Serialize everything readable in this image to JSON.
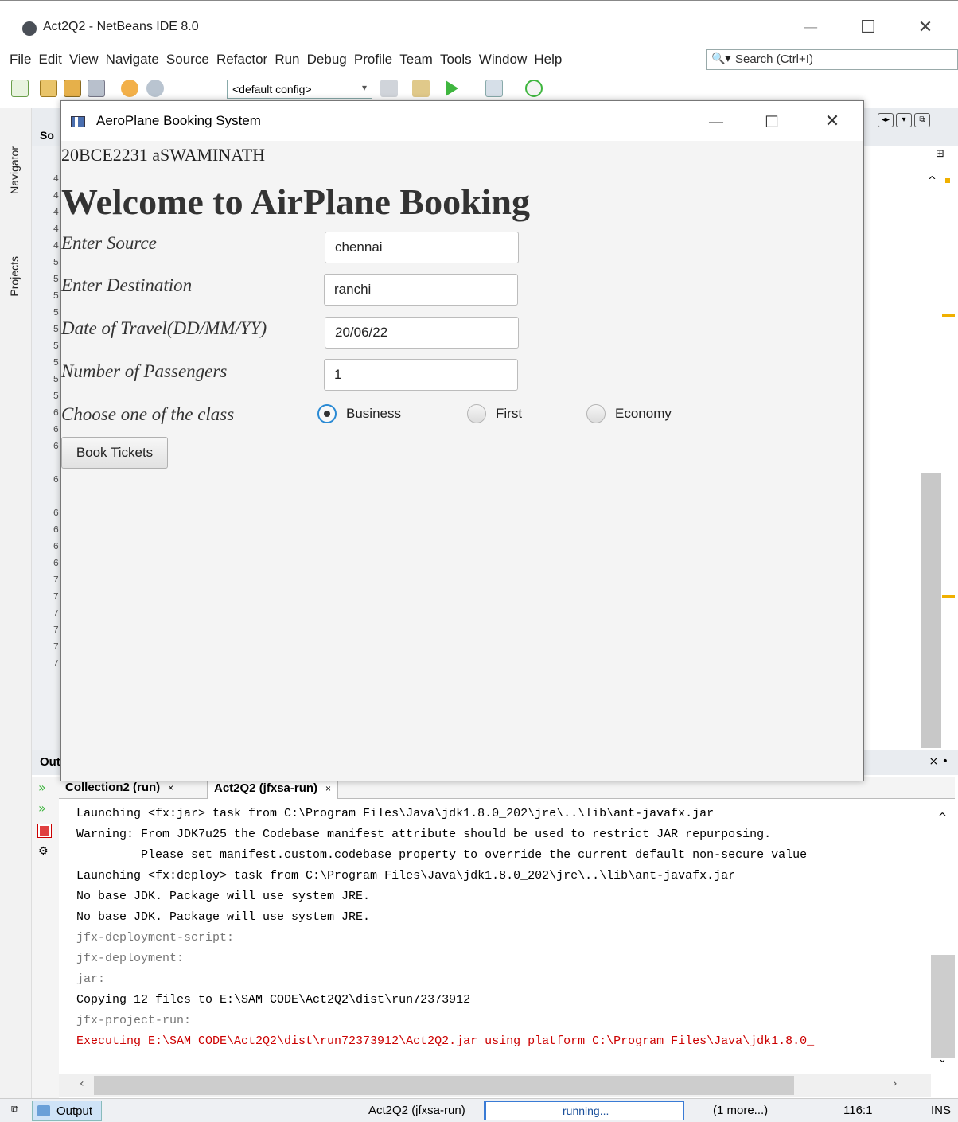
{
  "ide": {
    "title": "Act2Q2 - NetBeans IDE 8.0",
    "menu": [
      "File",
      "Edit",
      "View",
      "Navigate",
      "Source",
      "Refactor",
      "Run",
      "Debug",
      "Profile",
      "Team",
      "Tools",
      "Window",
      "Help"
    ],
    "search_placeholder": "Search (Ctrl+I)",
    "config": "<default config>",
    "side_tabs": {
      "navigator": "Navigator",
      "projects": "Projects"
    },
    "editor_tab_fragment": "So",
    "line_numbers": [
      "4",
      "4",
      "4",
      "4",
      "4",
      "5",
      "5",
      "5",
      "5",
      "5",
      "5",
      "5",
      "5",
      "5",
      "6",
      "6",
      "6",
      "6",
      "6",
      "6",
      "6",
      "6",
      "7",
      "7",
      "7",
      "7",
      "7",
      "7"
    ]
  },
  "output": {
    "panel_title": "Out",
    "tabs": [
      {
        "label": "Collection2 (run)",
        "close": "×"
      },
      {
        "label": "Act2Q2 (jfxsa-run)",
        "close": "×"
      }
    ],
    "lines": [
      {
        "text": "Launching <fx:jar> task from C:\\Program Files\\Java\\jdk1.8.0_202\\jre\\..\\lib\\ant-javafx.jar",
        "style": "normal"
      },
      {
        "text": "Warning: From JDK7u25 the Codebase manifest attribute should be used to restrict JAR repurposing.",
        "style": "normal"
      },
      {
        "text": "         Please set manifest.custom.codebase property to override the current default non-secure value",
        "style": "normal"
      },
      {
        "text": "Launching <fx:deploy> task from C:\\Program Files\\Java\\jdk1.8.0_202\\jre\\..\\lib\\ant-javafx.jar",
        "style": "normal"
      },
      {
        "text": "No base JDK. Package will use system JRE.",
        "style": "normal"
      },
      {
        "text": "No base JDK. Package will use system JRE.",
        "style": "normal"
      },
      {
        "text": "jfx-deployment-script:",
        "style": "gray"
      },
      {
        "text": "jfx-deployment:",
        "style": "gray"
      },
      {
        "text": "jar:",
        "style": "gray"
      },
      {
        "text": "Copying 12 files to E:\\SAM CODE\\Act2Q2\\dist\\run72373912",
        "style": "normal"
      },
      {
        "text": "jfx-project-run:",
        "style": "gray"
      },
      {
        "text": "Executing E:\\SAM CODE\\Act2Q2\\dist\\run72373912\\Act2Q2.jar using platform C:\\Program Files\\Java\\jdk1.8.0_",
        "style": "red"
      }
    ]
  },
  "statusbar": {
    "output_label": "Output",
    "task": "Act2Q2 (jfxsa-run)",
    "progress_text": "running...",
    "more": "(1 more...)",
    "position": "116:1",
    "mode": "INS"
  },
  "app": {
    "title": "AeroPlane Booking System",
    "reg_line": "20BCE2231 aSWAMINATH",
    "heading": "Welcome to AirPlane Booking",
    "fields": [
      {
        "label": "Enter Source",
        "value": "chennai"
      },
      {
        "label": "Enter Destination",
        "value": "ranchi"
      },
      {
        "label": "Date of Travel(DD/MM/YY)",
        "value": "20/06/22"
      },
      {
        "label": "Number of Passengers",
        "value": "1"
      }
    ],
    "class_label": "Choose one of the class",
    "classes": [
      "Business",
      "First",
      "Economy"
    ],
    "selected_class": "Business",
    "book_button": "Book Tickets"
  }
}
